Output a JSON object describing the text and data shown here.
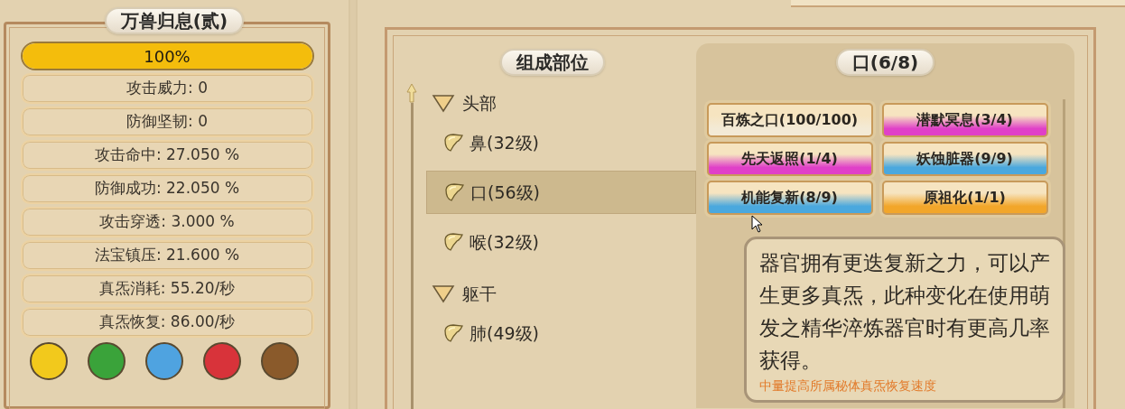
{
  "skill_panel": {
    "title": "万兽归息(贰)",
    "progress": {
      "label": "100%",
      "level": 1.0
    },
    "stats": [
      "攻击威力: 0",
      "防御坚韧: 0",
      "攻击命中: 27.050 %",
      "防御成功: 22.050 %",
      "攻击穿透: 3.000 %",
      "法宝镇压: 21.600 %",
      "真炁消耗: 55.20/秒",
      "真炁恢复: 86.00/秒"
    ],
    "element_buttons": [
      {
        "color": "#f2c91c"
      },
      {
        "color": "#3aa33a"
      },
      {
        "color": "#4fa3e0"
      },
      {
        "color": "#d8333a"
      },
      {
        "color": "#8a5a2b"
      }
    ]
  },
  "parts": {
    "title": "组成部位",
    "tree": [
      {
        "label": "头部",
        "expanded": true,
        "children": [
          {
            "label": "鼻(32级)",
            "selected": false
          },
          {
            "label": "口(56级)",
            "selected": true
          },
          {
            "label": "喉(32级)",
            "selected": false
          }
        ]
      },
      {
        "label": "躯干",
        "expanded": true,
        "children": [
          {
            "label": "肺(49级)",
            "selected": false
          }
        ]
      }
    ]
  },
  "traits": {
    "title": "口(6/8)",
    "items": [
      {
        "label": "百炼之口(100/100)",
        "color": "#f3ead6"
      },
      {
        "label": "潜默冥息(3/4)",
        "color": "#e040c8"
      },
      {
        "label": "先天返照(1/4)",
        "color": "#e040c8"
      },
      {
        "label": "妖蚀脏器(9/9)",
        "color": "#4aa8de"
      },
      {
        "label": "机能复新(8/9)",
        "color": "#4aa8de"
      },
      {
        "label": "原祖化(1/1)",
        "color": "#f2a62a"
      }
    ]
  },
  "tooltip": {
    "description": "器官拥有更迭复新之力，可以产生更多真炁，此种变化在使用萌发之精华淬炼器官时有更高几率获得。",
    "effect": "中量提高所属秘体真炁恢复速度"
  }
}
